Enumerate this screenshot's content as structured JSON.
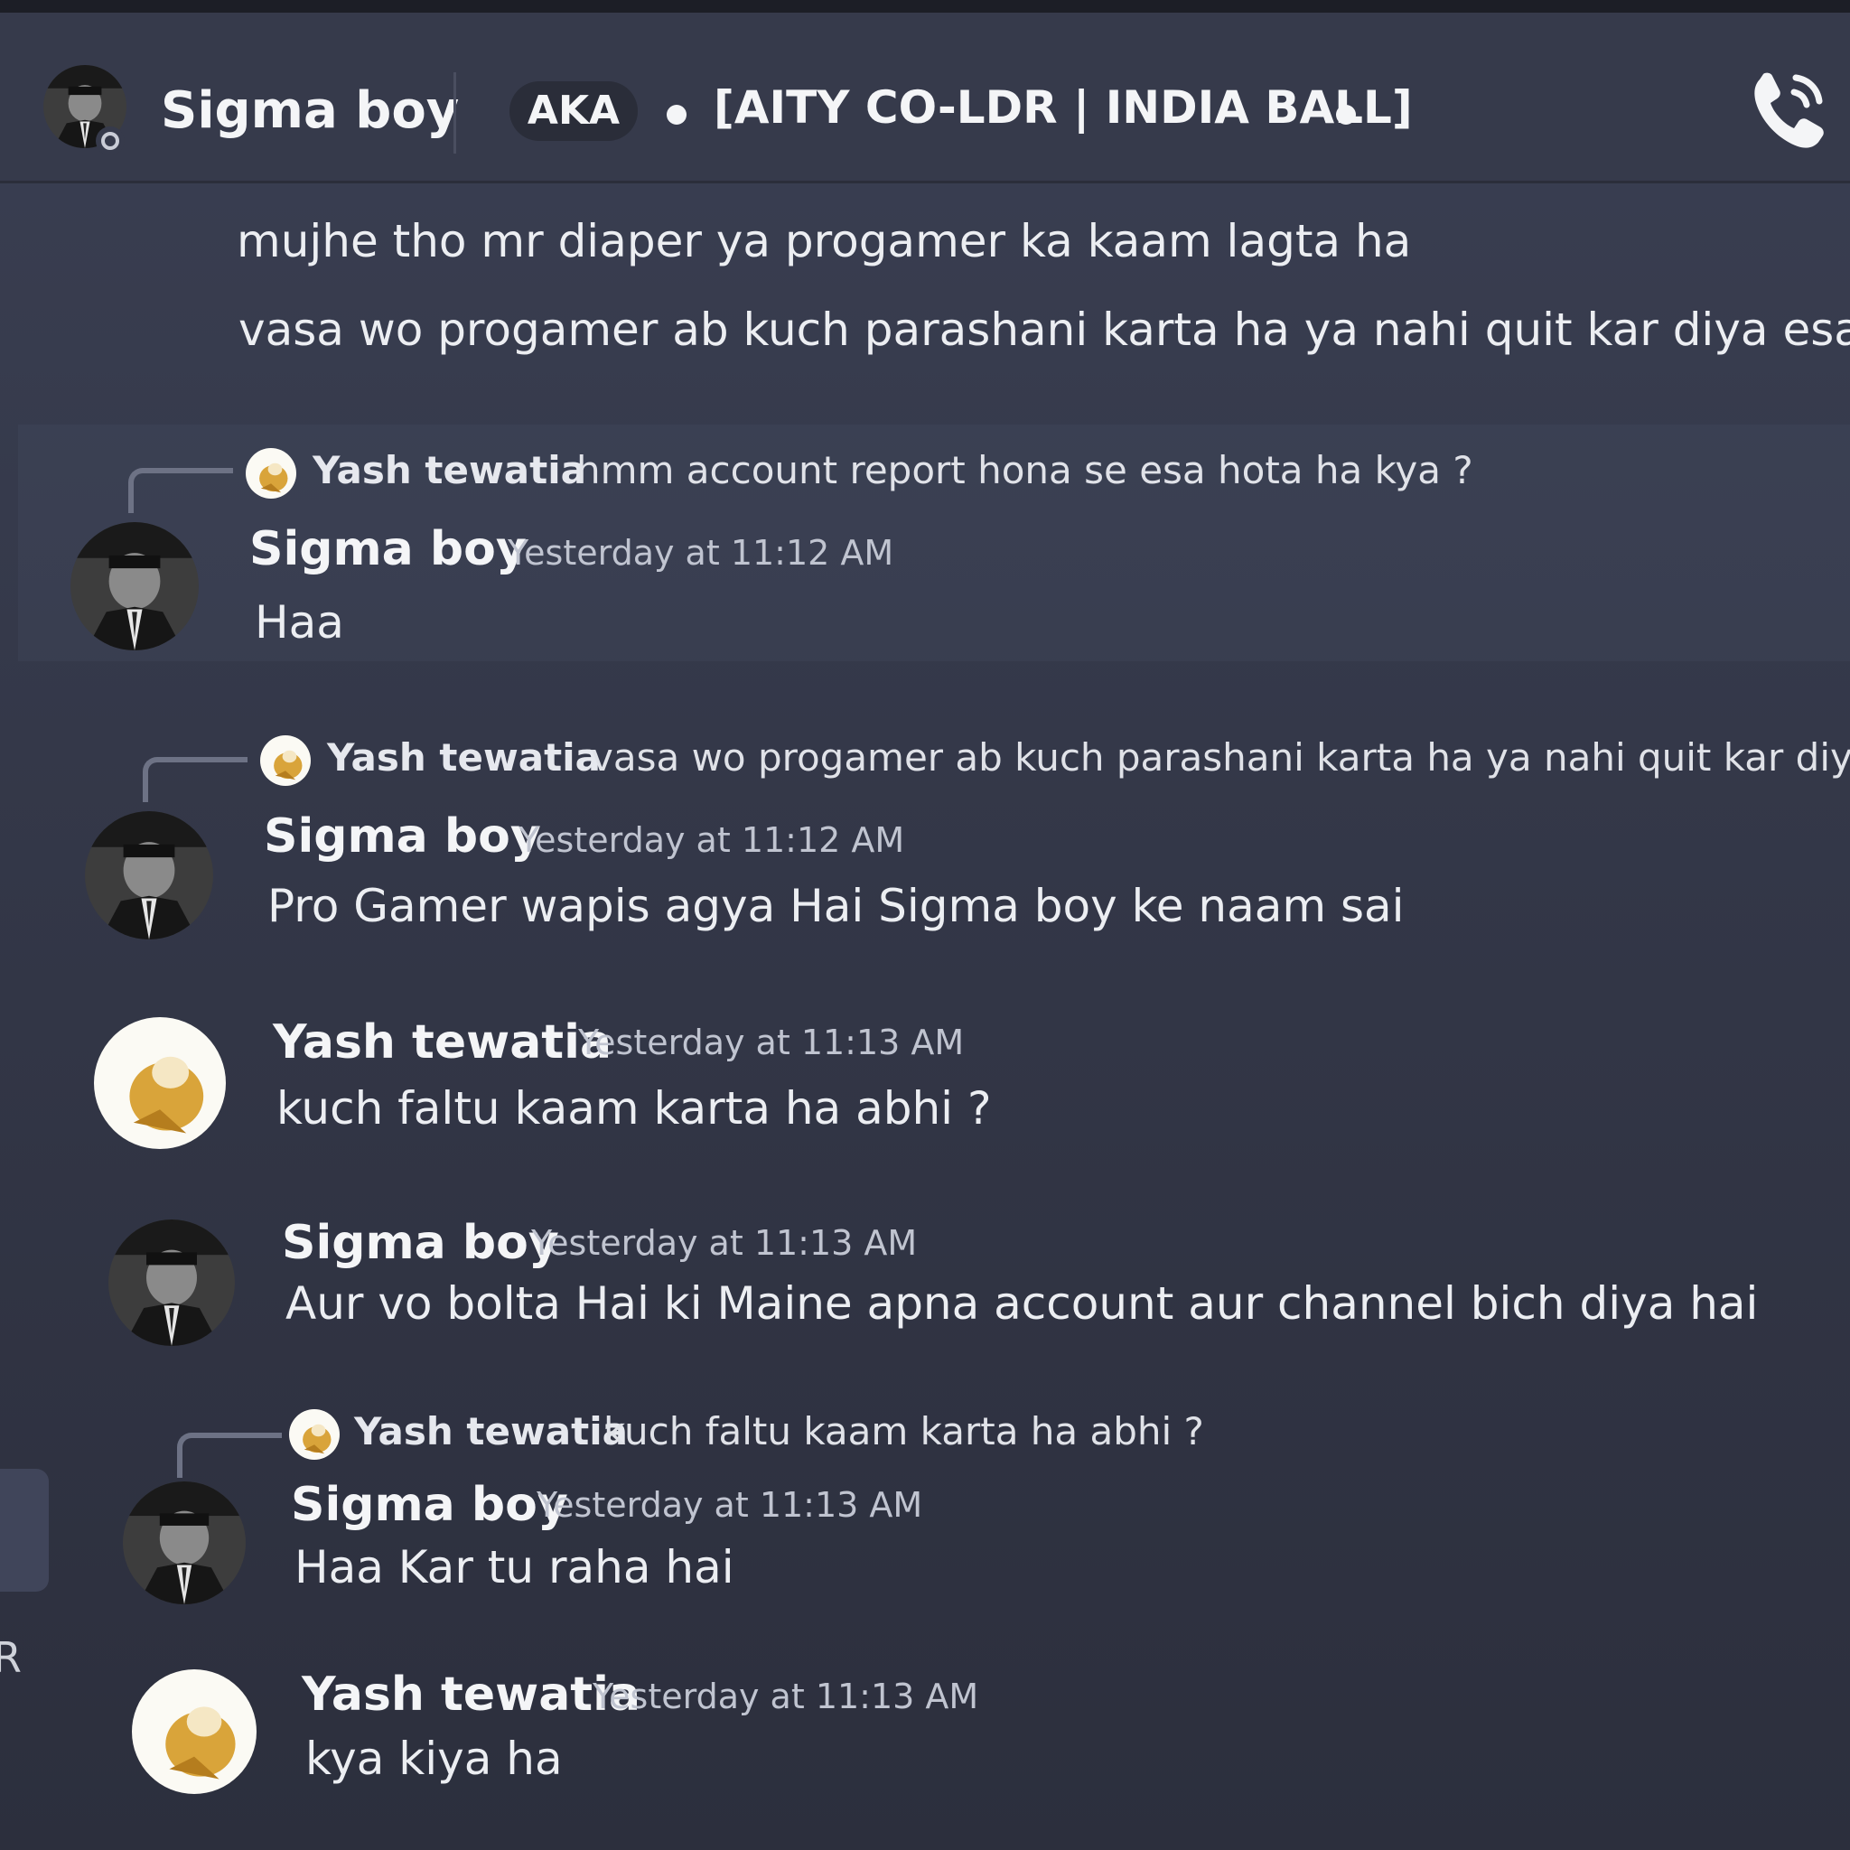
{
  "header": {
    "username": "Sigma boy",
    "tag": "AKA",
    "clan": "[AITY CO-LDR | INDIA BALL]",
    "call_icon": "phone-call-icon"
  },
  "continued": {
    "line1": "mujhe tho mr diaper ya progamer ka kaam lagta ha",
    "line2": "vasa wo progamer ab kuch parashani karta ha ya nahi quit kar diya esa li"
  },
  "messages": [
    {
      "reply": {
        "author": "Yash tewatia",
        "text": "hmm account report hona se esa hota ha kya ?"
      },
      "author": "Sigma boy",
      "timestamp": "Yesterday at 11:12 AM",
      "text": "Haa"
    },
    {
      "reply": {
        "author": "Yash tewatia",
        "text": "vasa wo progamer ab kuch parashani karta ha ya nahi quit kar diya"
      },
      "author": "Sigma boy",
      "timestamp": "Yesterday at 11:12 AM",
      "text": "Pro Gamer wapis agya Hai Sigma boy ke naam sai"
    },
    {
      "author": "Yash tewatia",
      "timestamp": "Yesterday at 11:13 AM",
      "text": "kuch faltu kaam karta ha abhi ?"
    },
    {
      "author": "Sigma boy",
      "timestamp": "Yesterday at 11:13 AM",
      "text": "Aur vo bolta Hai ki Maine apna account aur channel bich diya hai"
    },
    {
      "reply": {
        "author": "Yash tewatia",
        "text": "kuch faltu kaam karta ha abhi ?"
      },
      "author": "Sigma boy",
      "timestamp": "Yesterday at 11:13 AM",
      "text": "Haa Kar tu raha hai"
    },
    {
      "author": "Yash tewatia",
      "timestamp": "Yesterday at 11:13 AM",
      "text": "kya kiya ha"
    }
  ],
  "sidebar": {
    "edge_letter": "R"
  },
  "colors": {
    "background": "#343849",
    "header": "#363a4b",
    "text": "#eceef2",
    "timestamp": "#c0c4d0"
  }
}
